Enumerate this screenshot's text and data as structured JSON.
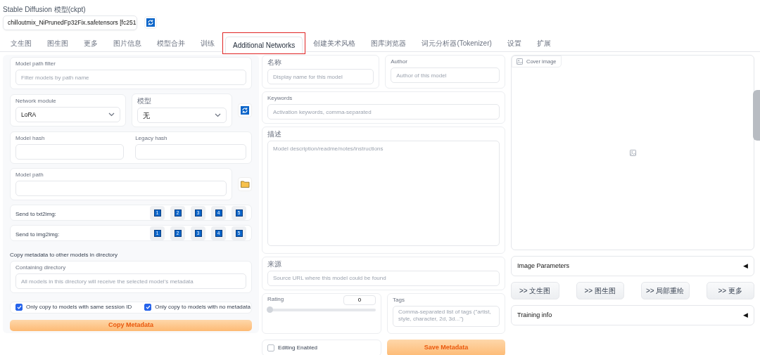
{
  "checkpoint": {
    "label": "Stable Diffusion 模型(ckpt)",
    "value": "chilloutmix_NiPrunedFp32Fix.safetensors [fc251"
  },
  "tabs": [
    {
      "label": "文生图",
      "selected": false,
      "highlighted": false
    },
    {
      "label": "图生图",
      "selected": false,
      "highlighted": false
    },
    {
      "label": "更多",
      "selected": false,
      "highlighted": false
    },
    {
      "label": "图片信息",
      "selected": false,
      "highlighted": false
    },
    {
      "label": "模型合并",
      "selected": false,
      "highlighted": false
    },
    {
      "label": "训练",
      "selected": false,
      "highlighted": false
    },
    {
      "label": "Additional Networks",
      "selected": true,
      "highlighted": true
    },
    {
      "label": "创建美术风格",
      "selected": false,
      "highlighted": false
    },
    {
      "label": "图库浏览器",
      "selected": false,
      "highlighted": false
    },
    {
      "label": "词元分析器(Tokenizer)",
      "selected": false,
      "highlighted": false
    },
    {
      "label": "设置",
      "selected": false,
      "highlighted": false
    },
    {
      "label": "扩展",
      "selected": false,
      "highlighted": false
    }
  ],
  "left": {
    "path_filter": {
      "label": "Model path filter",
      "placeholder": "Filter models by path name"
    },
    "network_module": {
      "label": "Network module",
      "value": "LoRA"
    },
    "model": {
      "label": "模型",
      "value": "无"
    },
    "model_hash": {
      "label": "Model hash"
    },
    "legacy_hash": {
      "label": "Legacy hash"
    },
    "model_path": {
      "label": "Model path"
    },
    "send_rows": [
      {
        "label": "Send to txt2img:",
        "buttons": [
          "1",
          "2",
          "3",
          "4",
          "5"
        ]
      },
      {
        "label": "Send to img2img:",
        "buttons": [
          "1",
          "2",
          "3",
          "4",
          "5"
        ]
      }
    ],
    "copy_heading": "Copy metadata to other models in directory",
    "containing_directory": {
      "label": "Containing directory",
      "placeholder": "All models in this directory will receive the selected model's metadata"
    },
    "checkboxes": [
      {
        "label": "Only copy to models with same session ID",
        "checked": true
      },
      {
        "label": "Only copy to models with no metadata",
        "checked": true
      }
    ],
    "copy_button": "Copy Metadata"
  },
  "middle": {
    "name": {
      "label": "名称",
      "placeholder": "Display name for this model"
    },
    "author": {
      "label": "Author",
      "placeholder": "Author of this model"
    },
    "keywords": {
      "label": "Keywords",
      "placeholder": "Activation keywords, comma-separated"
    },
    "description": {
      "label": "描述",
      "placeholder": "Model description/readme/notes/instructions"
    },
    "source": {
      "label": "来源",
      "placeholder": "Source URL where this model could be found"
    },
    "rating": {
      "label": "Rating",
      "value": "0",
      "level": 0
    },
    "tags": {
      "label": "Tags",
      "placeholder": "Comma-separated list of tags (\"artist, style, character, 2d, 3d...\")"
    },
    "editing": {
      "label": "Editing Enabled",
      "checked": false
    },
    "save_button": "Save Metadata"
  },
  "right": {
    "cover_label": "Cover image",
    "image_parameters": {
      "label": "Image Parameters",
      "toggle": "◀"
    },
    "send_buttons": [
      ">> 文生图",
      ">> 图生图",
      ">> 局部重绘",
      ">> 更多"
    ],
    "training_info": {
      "label": "Training info",
      "toggle": "◀"
    }
  }
}
